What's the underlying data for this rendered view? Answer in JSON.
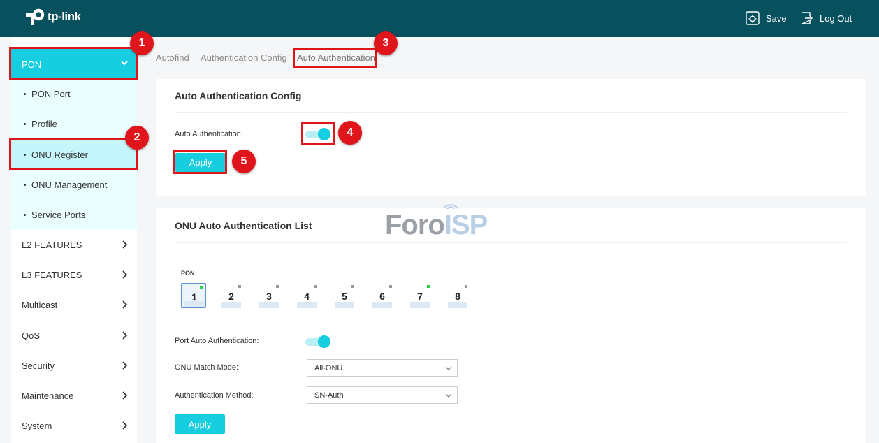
{
  "header": {
    "brand": "tp-link",
    "save_label": "Save",
    "logout_label": "Log Out",
    "save_icon": "save-icon",
    "logout_icon": "logout-icon",
    "bg_color": "#07505e"
  },
  "sidebar": {
    "pon_label": "PON",
    "sub_items": [
      {
        "label": "PON Port"
      },
      {
        "label": "Profile"
      },
      {
        "label": "ONU Register",
        "active": true
      },
      {
        "label": "ONU Management"
      },
      {
        "label": "Service Ports"
      }
    ],
    "items": [
      {
        "label": "L2 FEATURES"
      },
      {
        "label": "L3 FEATURES"
      },
      {
        "label": "Multicast"
      },
      {
        "label": "QoS"
      },
      {
        "label": "Security"
      },
      {
        "label": "Maintenance"
      },
      {
        "label": "System"
      }
    ]
  },
  "tabs": [
    {
      "label": "Autofind"
    },
    {
      "label": "Authentication Config"
    },
    {
      "label": "Auto Authentication",
      "active": true
    }
  ],
  "config_card": {
    "title": "Auto Authentication Config",
    "auto_auth_label": "Auto Authentication:",
    "auto_auth_enabled": true,
    "apply_label": "Apply"
  },
  "list_card": {
    "title": "ONU Auto Authentication List",
    "pon_label": "PON",
    "ports": [
      {
        "num": "1",
        "selected": true,
        "link": true
      },
      {
        "num": "2",
        "link": false
      },
      {
        "num": "3",
        "link": false
      },
      {
        "num": "4",
        "link": false
      },
      {
        "num": "5",
        "link": false
      },
      {
        "num": "6",
        "link": false
      },
      {
        "num": "7",
        "link": true
      },
      {
        "num": "8",
        "link": false
      }
    ],
    "port_auto_auth_label": "Port Auto Authentication:",
    "port_auto_auth_enabled": true,
    "match_mode_label": "ONU Match Mode:",
    "match_mode_value": "All-ONU",
    "auth_method_label": "Authentication Method:",
    "auth_method_value": "SN-Auth",
    "apply_label": "Apply"
  },
  "annotations": {
    "badges": [
      "1",
      "2",
      "3",
      "4",
      "5"
    ],
    "color": "#e0151c"
  },
  "watermark": {
    "part1": "Foro",
    "part2": "ISP"
  },
  "colors": {
    "accent": "#17cde0",
    "submenu_bg": "#eafdff",
    "submenu_active": "#c5f6fb"
  }
}
